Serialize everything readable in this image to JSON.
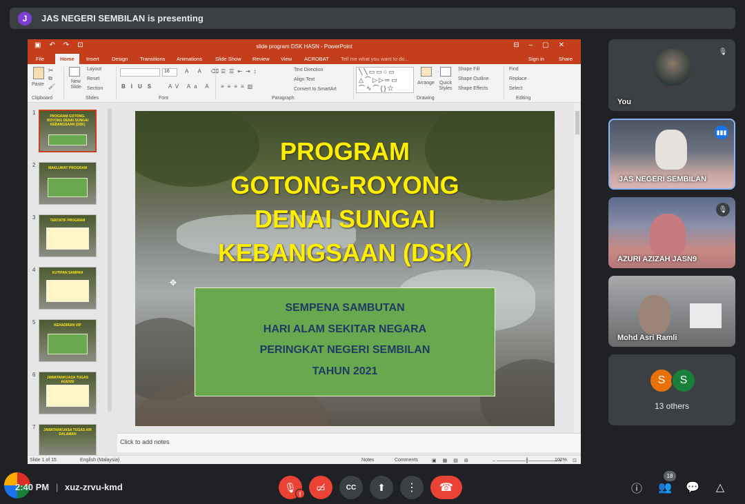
{
  "presenting": {
    "avatar": "J",
    "text": "JAS NEGERI SEMBILAN is presenting"
  },
  "powerpoint": {
    "title": "slide program DSK HASN - PowerPoint",
    "tabs": [
      "File",
      "Home",
      "Insert",
      "Design",
      "Transitions",
      "Animations",
      "Slide Show",
      "Review",
      "View",
      "ACROBAT",
      "Tell me what you want to do...",
      "Sign in",
      "Share"
    ],
    "ribbon": {
      "paste": "Paste",
      "new_slide": "New Slide",
      "layout": "Layout",
      "reset": "Reset",
      "section": "Section",
      "font_size": "16",
      "text_direction": "Text Direction",
      "align_text": "Align Text",
      "convert_smartart": "Convert to SmartArt",
      "arrange": "Arrange",
      "quick_styles": "Quick Styles",
      "shape_fill": "Shape Fill",
      "shape_outline": "Shape Outline",
      "shape_effects": "Shape Effects",
      "find": "Find",
      "replace": "Replace",
      "select": "Select",
      "groups": [
        "Clipboard",
        "Slides",
        "Font",
        "Paragraph",
        "Drawing",
        "Editing"
      ]
    },
    "thumbnails": [
      {
        "num": "1",
        "title": "PROGRAM GOTONG-ROYONG DENAI SUNGAI KEBANGSAAN (DSK)"
      },
      {
        "num": "2",
        "title": "MAKLUMAT PROGRAM"
      },
      {
        "num": "3",
        "title": "TENTATIF PROGRAM"
      },
      {
        "num": "4",
        "title": "KUTIPAN SAMPAH"
      },
      {
        "num": "5",
        "title": "KEHADIRAN VIP"
      },
      {
        "num": "6",
        "title": "JAWATANKUASA TUGAS AGENSI"
      },
      {
        "num": "7",
        "title": "JAWATANKUASA TUGAS AIR DALAMAN"
      }
    ],
    "slide": {
      "title_lines": [
        "PROGRAM",
        "GOTONG-ROYONG",
        "DENAI SUNGAI",
        "KEBANGSAAN (DSK)"
      ],
      "box_lines": [
        "SEMPENA SAMBUTAN",
        "HARI ALAM SEKITAR NEGARA",
        "PERINGKAT NEGERI SEMBILAN",
        "TAHUN 2021"
      ]
    },
    "notes_placeholder": "Click to add notes",
    "status": {
      "slide": "Slide 1 of 15",
      "language": "English (Malaysia)",
      "notes": "Notes",
      "comments": "Comments",
      "zoom": "102%"
    }
  },
  "participants": [
    {
      "name": "You",
      "muted": true
    },
    {
      "name": "JAS NEGERI SEMBILAN",
      "speaking": true
    },
    {
      "name": "AZURI AZIZAH JASN9",
      "muted": true
    },
    {
      "name": "Mohd Asri Ramli"
    }
  ],
  "others": {
    "avatars": [
      "S",
      "S"
    ],
    "avatar_colors": [
      "#e8710a",
      "#188038"
    ],
    "label": "13 others"
  },
  "bottom": {
    "time": "2:40 PM",
    "separator": "|",
    "meeting_code": "xuz-zrvu-kmd",
    "people_count": "18"
  },
  "colors": {
    "ppt_accent": "#c43e1c",
    "slide_title": "#ffee00",
    "slide_box": "#6aa84f",
    "hangup": "#ea4335",
    "speaking": "#1a73e8"
  }
}
